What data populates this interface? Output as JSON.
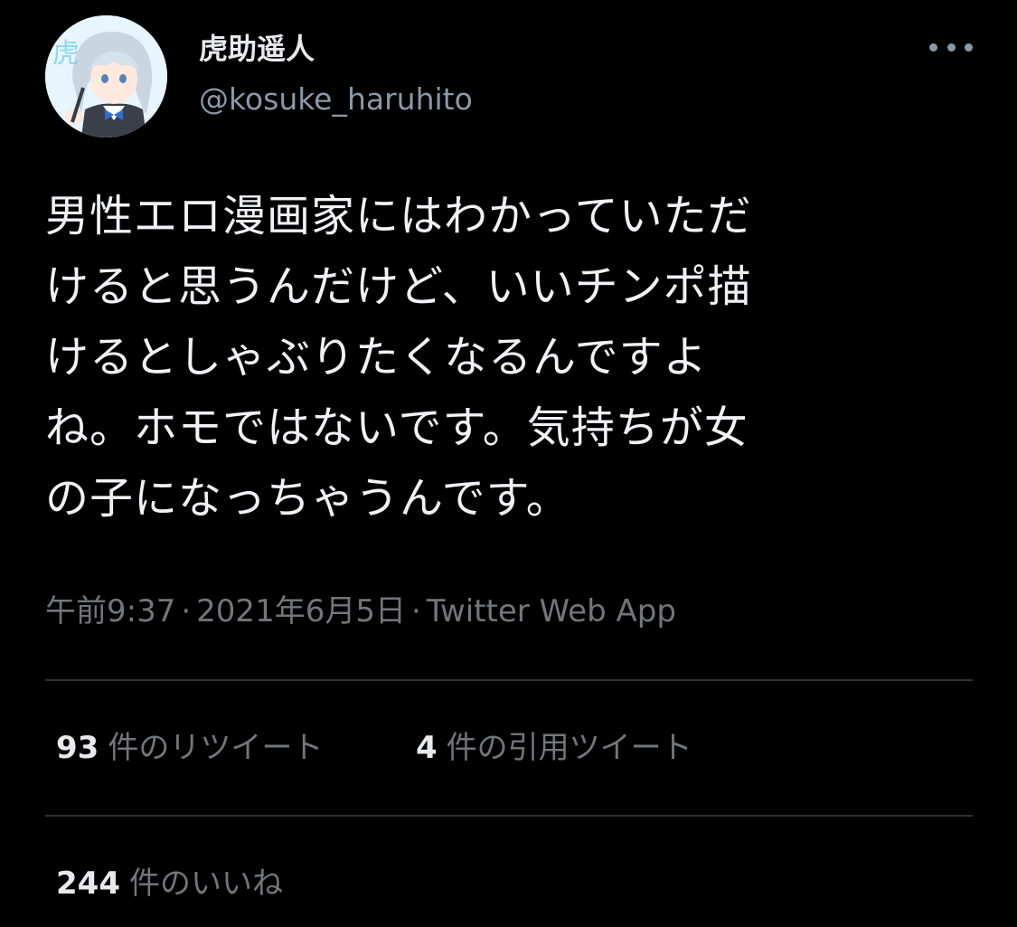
{
  "user": {
    "display_name": "虎助遥人",
    "handle": "@kosuke_haruhito"
  },
  "tweet": {
    "lines": [
      "男性エロ漫画家にはわかっていただ",
      "けると思うんだけど、いいチンポ描",
      "けるとしゃぶりたくなるんですよ",
      "ね。ホモではないです。気持ちが女",
      "の子になっちゃうんです。"
    ]
  },
  "meta": {
    "time": "午前9:37",
    "separator": "·",
    "date": "2021年6月5日",
    "source": "Twitter Web App"
  },
  "stats": {
    "retweets": {
      "count": "93",
      "label": "件のリツイート"
    },
    "quotes": {
      "count": "4",
      "label": "件の引用ツイート"
    },
    "likes": {
      "count": "244",
      "label": "件のいいね"
    }
  },
  "icons": {
    "more": "more-horizontal-icon"
  },
  "colors": {
    "background": "#000000",
    "primary_text": "#e7e9ea",
    "secondary_text": "#71767b",
    "divider": "#2f3336"
  }
}
